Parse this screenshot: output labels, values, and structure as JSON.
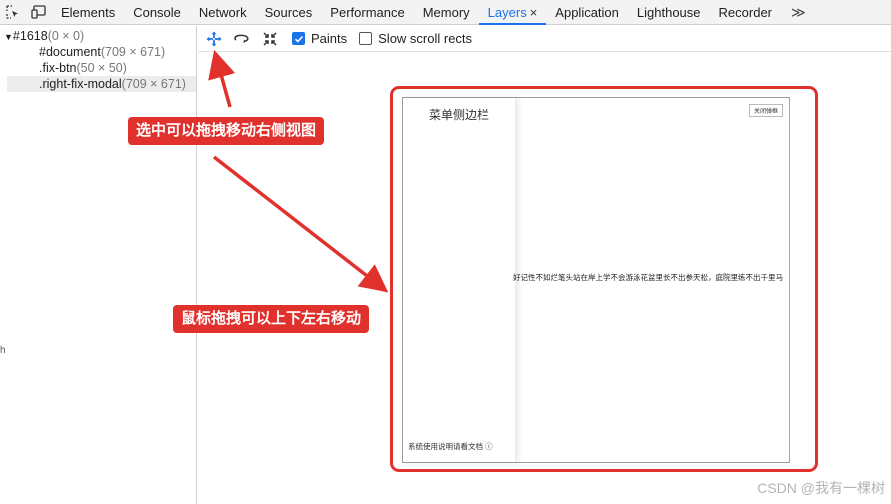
{
  "tabs": [
    {
      "label": "Elements"
    },
    {
      "label": "Console"
    },
    {
      "label": "Network"
    },
    {
      "label": "Sources"
    },
    {
      "label": "Performance"
    },
    {
      "label": "Memory"
    },
    {
      "label": "Layers",
      "close": "×"
    },
    {
      "label": "Application"
    },
    {
      "label": "Lighthouse"
    },
    {
      "label": "Recorder"
    }
  ],
  "more_label": "≫",
  "tree": {
    "root_name": "#1618",
    "root_size": "(0 × 0)",
    "items": [
      {
        "name": "#document",
        "size": "(709 × 671)"
      },
      {
        "name": ".fix-btn",
        "size": "(50 × 50)"
      },
      {
        "name": ".right-fix-modal",
        "size": "(709 × 671)"
      }
    ],
    "left_mark": "h"
  },
  "toolbar": {
    "paints_label": "Paints",
    "slow_scroll_label": "Slow scroll rects"
  },
  "annotations": {
    "drag_select": "选中可以拖拽移动右侧视图",
    "mouse_drag": "鼠标拖拽可以上下左右移动"
  },
  "preview": {
    "sidebar_title": "菜单侧边栏",
    "close_button": "关闭弹框",
    "poem_text": "好记性不如烂笔头站在岸上学不会游泳花盆里长不出参天松，庭院里练不出千里马",
    "footer_text": "系统使用说明请看文档 ⓘ"
  },
  "watermark": "CSDN @我有一棵树",
  "colors": {
    "accent": "#1a73e8",
    "annotation": "#e0312c"
  }
}
